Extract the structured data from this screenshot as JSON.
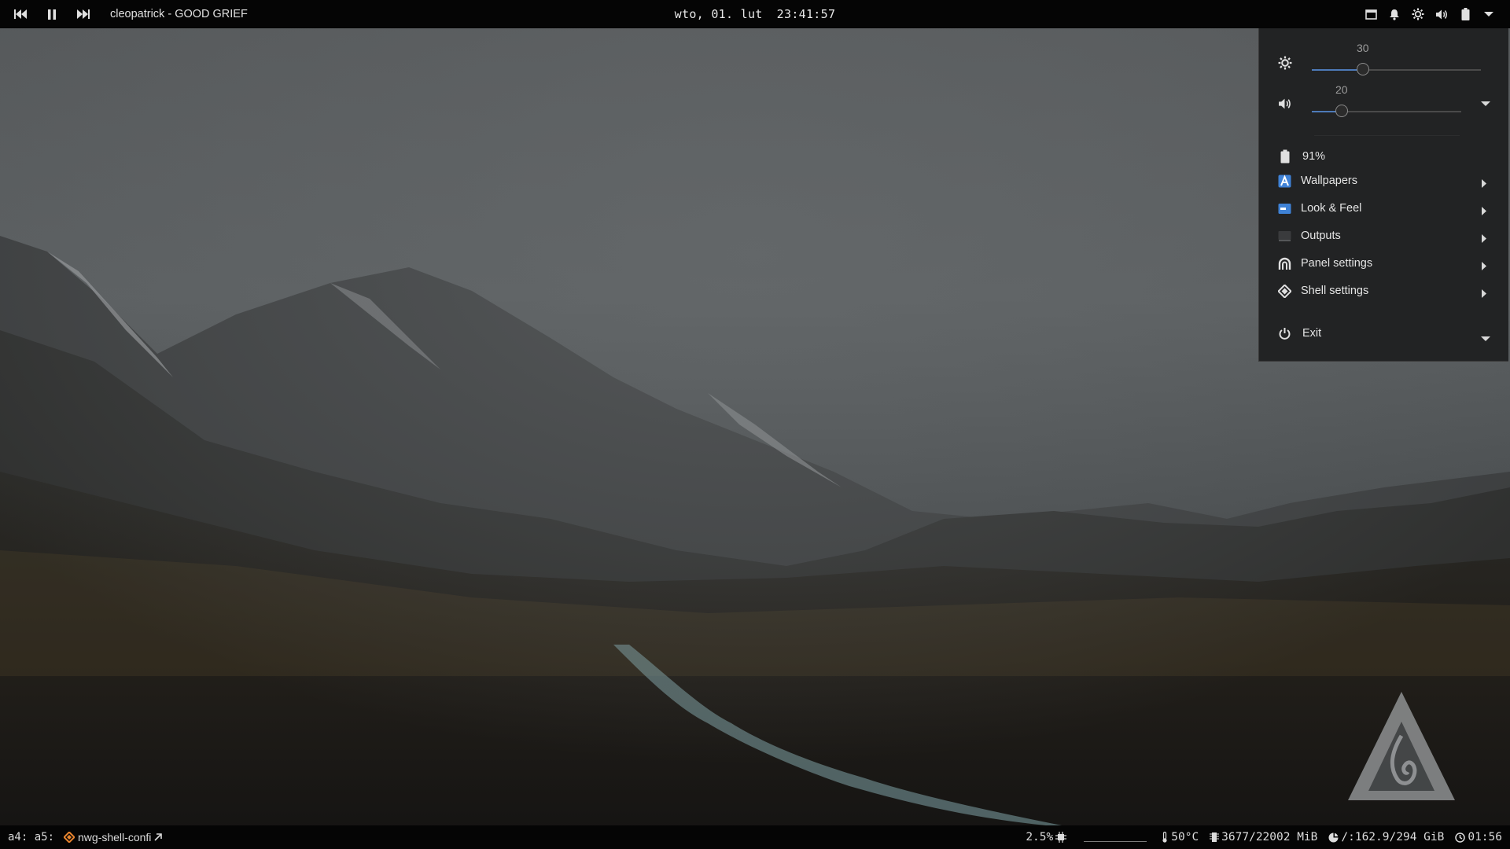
{
  "top_panel": {
    "media": {
      "prev_icon": "skip-previous-icon",
      "pause_icon": "pause-icon",
      "next_icon": "skip-next-icon",
      "track": "cleopatrick - GOOD GRIEF"
    },
    "clock": {
      "date": "wto, 01. lut",
      "time": "23:41:57"
    },
    "tray": [
      "window-icon",
      "bell-icon",
      "brightness-icon",
      "volume-icon",
      "battery-icon",
      "chevron-down-icon"
    ]
  },
  "control_center": {
    "brightness": {
      "value": "30",
      "level": 0.3,
      "icon": "brightness-icon"
    },
    "volume": {
      "value": "20",
      "level": 0.2,
      "icon": "volume-icon"
    },
    "battery": {
      "label": "91%",
      "icon": "battery-icon"
    },
    "menu": [
      {
        "label": "Wallpapers",
        "icon": "wallpaper-icon"
      },
      {
        "label": "Look & Feel",
        "icon": "look-feel-icon"
      },
      {
        "label": "Outputs",
        "icon": "display-icon"
      },
      {
        "label": "Panel settings",
        "icon": "panel-icon"
      },
      {
        "label": "Shell settings",
        "icon": "shell-icon"
      }
    ],
    "exit": {
      "label": "Exit",
      "icon": "power-icon"
    }
  },
  "bottom_panel": {
    "workspaces": "a4:  a5:",
    "task": {
      "label": "nwg-shell-confi",
      "icon": "nwg-shell-icon"
    },
    "cpu": "2.5%",
    "temperature": "50°C",
    "memory": "3677/22002 MiB",
    "disk": "/:162.9/294 GiB",
    "uptime": "01:56"
  },
  "colors": {
    "panel_bg": "#050505",
    "menu_bg": "#222324",
    "slider_accent": "#4d7ab8"
  }
}
